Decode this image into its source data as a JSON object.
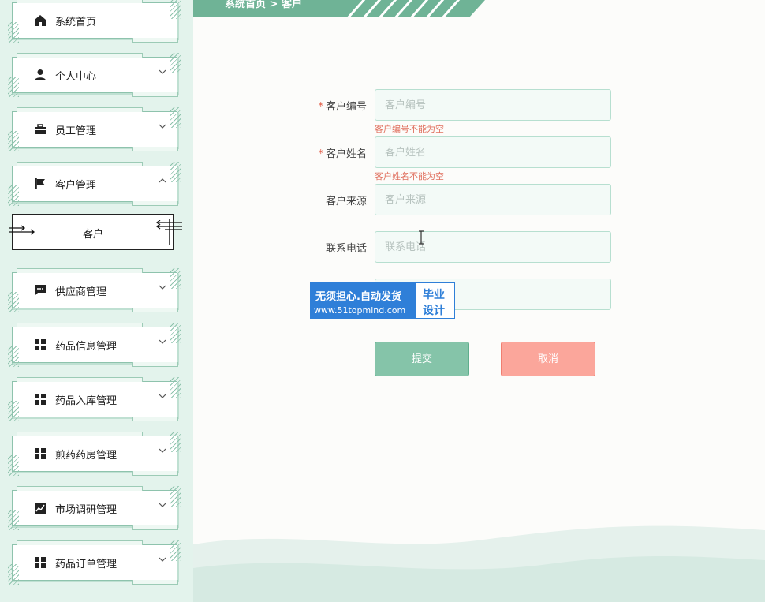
{
  "breadcrumb": {
    "text": "系统首页  >  客户"
  },
  "sidebar": {
    "items": [
      {
        "label": "系统首页",
        "icon": "home-icon",
        "has_arrow": false
      },
      {
        "label": "个人中心",
        "icon": "user-icon",
        "has_arrow": true,
        "arrow": "down"
      },
      {
        "label": "员工管理",
        "icon": "briefcase-icon",
        "has_arrow": true,
        "arrow": "down"
      },
      {
        "label": "客户管理",
        "icon": "flag-icon",
        "has_arrow": true,
        "arrow": "up"
      },
      {
        "label": "供应商管理",
        "icon": "chat-icon",
        "has_arrow": true,
        "arrow": "down"
      },
      {
        "label": "药品信息管理",
        "icon": "grid-icon",
        "has_arrow": true,
        "arrow": "down"
      },
      {
        "label": "药品入库管理",
        "icon": "grid-icon",
        "has_arrow": true,
        "arrow": "down"
      },
      {
        "label": "煎药药房管理",
        "icon": "grid-icon",
        "has_arrow": true,
        "arrow": "down"
      },
      {
        "label": "市场调研管理",
        "icon": "chart-icon",
        "has_arrow": true,
        "arrow": "down"
      },
      {
        "label": "药品订单管理",
        "icon": "grid-icon",
        "has_arrow": true,
        "arrow": "down"
      }
    ],
    "submenu": {
      "label": "客户"
    }
  },
  "form": {
    "fields": [
      {
        "label": "客户编号",
        "required": true,
        "placeholder": "客户编号",
        "error": "客户编号不能为空"
      },
      {
        "label": "客户姓名",
        "required": true,
        "placeholder": "客户姓名",
        "error": "客户姓名不能为空"
      },
      {
        "label": "客户来源",
        "required": false,
        "placeholder": "客户来源"
      },
      {
        "label": "联系电话",
        "required": false,
        "placeholder": "联系电话"
      },
      {
        "label": "",
        "required": false,
        "placeholder": ""
      }
    ],
    "submit_label": "提交",
    "cancel_label": "取消",
    "required_mark": "*"
  },
  "watermark": {
    "line1": "无须担心.自动发货",
    "line2": "www.51topmind.com",
    "right1": "毕业",
    "right2": "设计"
  },
  "colors": {
    "accent": "#5fae8d",
    "sidebar_bg": "#e3f3ec",
    "error": "#e0705f",
    "cancel": "#fba69b"
  }
}
